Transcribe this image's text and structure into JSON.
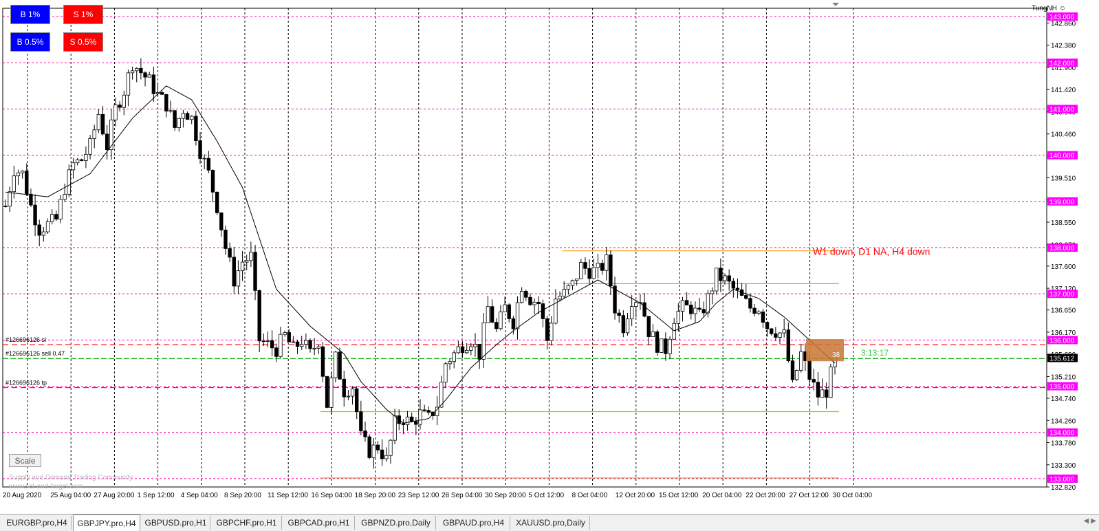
{
  "trade_buttons": [
    {
      "label": "B 1%",
      "kind": "buy"
    },
    {
      "label": "S 1%",
      "kind": "sell"
    },
    {
      "label": "B 0.5%",
      "kind": "buy"
    },
    {
      "label": "S 0.5%",
      "kind": "sell"
    }
  ],
  "scale_button": "Scale",
  "watermark": {
    "line1": "Supply and Demand Trading Community",
    "line2": "www.set-and-forget.com"
  },
  "user_label": "TungNH",
  "annotation_text": "W1 down, D1 NA, H4 down",
  "timer_text": "3:13:17",
  "tick_count_text": "38",
  "order_labels": {
    "sl": "#126696126 sl",
    "entry": "#126696126 sell 0.47",
    "tp": "#126696126 tp"
  },
  "colors": {
    "bull": "#000000",
    "bear": "#000000",
    "grid": "#000000",
    "level_line": "#ff00aa",
    "level_label_bg": "#ff00ff",
    "order_line": "#ff0000",
    "entry_line": "#00aa00",
    "ma_line": "#000000",
    "zone_line": "#ff9900",
    "support_line": "#66dd00",
    "annotation": "#ff0000",
    "timer": "#33cc33",
    "current_price_bg": "#000000"
  },
  "chart_data": {
    "type": "candlestick",
    "symbol": "GBPJPY.pro",
    "timeframe": "H4",
    "ylim": [
      132.82,
      143.18
    ],
    "current_price": 135.612,
    "y_ticks": [
      "142.860",
      "142.380",
      "141.900",
      "141.420",
      "140.940",
      "140.460",
      "139.980",
      "139.510",
      "139.030",
      "138.550",
      "138.070",
      "137.600",
      "137.120",
      "136.650",
      "136.170",
      "135.690",
      "135.210",
      "134.740",
      "134.260",
      "133.780",
      "133.300",
      "132.820"
    ],
    "x_labels": [
      "20 Aug 2020",
      "25 Aug 04:00",
      "27 Aug 20:00",
      "1 Sep 12:00",
      "4 Sep 04:00",
      "8 Sep 20:00",
      "11 Sep 12:00",
      "16 Sep 04:00",
      "18 Sep 20:00",
      "23 Sep 12:00",
      "28 Sep 04:00",
      "30 Sep 20:00",
      "5 Oct 12:00",
      "8 Oct 04:00",
      "12 Oct 20:00",
      "15 Oct 12:00",
      "20 Oct 04:00",
      "22 Oct 20:00",
      "27 Oct 12:00",
      "30 Oct 04:00"
    ],
    "horizontal_levels": [
      "143.000",
      "142.000",
      "141.000",
      "140.000",
      "139.000",
      "138.000",
      "137.000",
      "136.000",
      "135.000",
      "134.000",
      "133.000"
    ],
    "orders": {
      "sl": 135.9,
      "entry": 135.6,
      "tp": 134.97
    },
    "zones": {
      "resistance_top": 137.93,
      "resistance_bottom": 137.22,
      "support": 134.45,
      "base": 133.0
    },
    "close_path": [
      [
        0,
        138.9
      ],
      [
        2,
        139.7
      ],
      [
        4,
        139.6
      ],
      [
        6,
        138.9
      ],
      [
        8,
        138.4
      ],
      [
        10,
        138.5
      ],
      [
        12,
        138.6
      ],
      [
        14,
        139.3
      ],
      [
        16,
        139.8
      ],
      [
        18,
        139.9
      ],
      [
        20,
        140.2
      ],
      [
        22,
        140.9
      ],
      [
        24,
        140.2
      ],
      [
        26,
        141.0
      ],
      [
        28,
        141.4
      ],
      [
        30,
        142.0
      ],
      [
        32,
        141.8
      ],
      [
        34,
        141.6
      ],
      [
        36,
        141.3
      ],
      [
        38,
        141.1
      ],
      [
        40,
        140.6
      ],
      [
        42,
        141.0
      ],
      [
        44,
        140.8
      ],
      [
        46,
        140.1
      ],
      [
        48,
        139.6
      ],
      [
        50,
        138.9
      ],
      [
        52,
        138.0
      ],
      [
        54,
        137.3
      ],
      [
        56,
        137.7
      ],
      [
        58,
        137.8
      ],
      [
        60,
        136.0
      ],
      [
        62,
        135.9
      ],
      [
        64,
        135.8
      ],
      [
        66,
        136.1
      ],
      [
        68,
        135.8
      ],
      [
        70,
        136.0
      ],
      [
        72,
        135.7
      ],
      [
        74,
        136.0
      ],
      [
        76,
        134.6
      ],
      [
        78,
        135.6
      ],
      [
        80,
        134.9
      ],
      [
        82,
        135.0
      ],
      [
        84,
        133.9
      ],
      [
        86,
        133.6
      ],
      [
        88,
        133.7
      ],
      [
        90,
        133.4
      ],
      [
        92,
        134.2
      ],
      [
        94,
        134.3
      ],
      [
        96,
        134.2
      ],
      [
        98,
        134.4
      ],
      [
        100,
        134.3
      ],
      [
        102,
        134.6
      ],
      [
        104,
        135.5
      ],
      [
        106,
        135.7
      ],
      [
        108,
        135.9
      ],
      [
        110,
        136.0
      ],
      [
        112,
        135.7
      ],
      [
        114,
        136.7
      ],
      [
        116,
        136.2
      ],
      [
        118,
        136.7
      ],
      [
        120,
        136.4
      ],
      [
        122,
        137.2
      ],
      [
        124,
        136.9
      ],
      [
        126,
        136.8
      ],
      [
        128,
        136.0
      ],
      [
        130,
        136.9
      ],
      [
        132,
        137.0
      ],
      [
        134,
        137.2
      ],
      [
        136,
        137.6
      ],
      [
        138,
        137.5
      ],
      [
        140,
        137.5
      ],
      [
        142,
        137.7
      ],
      [
        144,
        136.7
      ],
      [
        146,
        136.3
      ],
      [
        148,
        136.9
      ],
      [
        150,
        136.9
      ],
      [
        152,
        136.2
      ],
      [
        154,
        135.9
      ],
      [
        156,
        135.8
      ],
      [
        158,
        136.5
      ],
      [
        160,
        136.7
      ],
      [
        162,
        136.7
      ],
      [
        164,
        136.5
      ],
      [
        166,
        136.9
      ],
      [
        168,
        137.4
      ],
      [
        170,
        137.3
      ],
      [
        172,
        137.1
      ],
      [
        174,
        136.9
      ],
      [
        176,
        136.7
      ],
      [
        178,
        136.7
      ],
      [
        180,
        136.3
      ],
      [
        182,
        136.2
      ],
      [
        184,
        136.1
      ],
      [
        186,
        135.0
      ],
      [
        188,
        135.7
      ],
      [
        190,
        135.2
      ],
      [
        192,
        134.8
      ],
      [
        194,
        134.9
      ],
      [
        196,
        135.6
      ]
    ],
    "ma_path": [
      [
        0,
        139.2
      ],
      [
        10,
        139.1
      ],
      [
        20,
        139.6
      ],
      [
        30,
        140.8
      ],
      [
        38,
        141.5
      ],
      [
        44,
        141.2
      ],
      [
        50,
        140.3
      ],
      [
        56,
        139.3
      ],
      [
        60,
        138.2
      ],
      [
        64,
        137.1
      ],
      [
        72,
        136.3
      ],
      [
        80,
        135.7
      ],
      [
        84,
        135.1
      ],
      [
        90,
        134.5
      ],
      [
        94,
        134.2
      ],
      [
        100,
        134.3
      ],
      [
        104,
        134.7
      ],
      [
        110,
        135.4
      ],
      [
        116,
        135.9
      ],
      [
        120,
        136.2
      ],
      [
        126,
        136.6
      ],
      [
        132,
        136.9
      ],
      [
        140,
        137.3
      ],
      [
        144,
        137.1
      ],
      [
        150,
        136.8
      ],
      [
        154,
        136.5
      ],
      [
        158,
        136.2
      ],
      [
        164,
        136.4
      ],
      [
        168,
        136.8
      ],
      [
        172,
        137.1
      ],
      [
        178,
        136.9
      ],
      [
        184,
        136.5
      ],
      [
        190,
        136.0
      ],
      [
        196,
        135.5
      ]
    ]
  }
}
